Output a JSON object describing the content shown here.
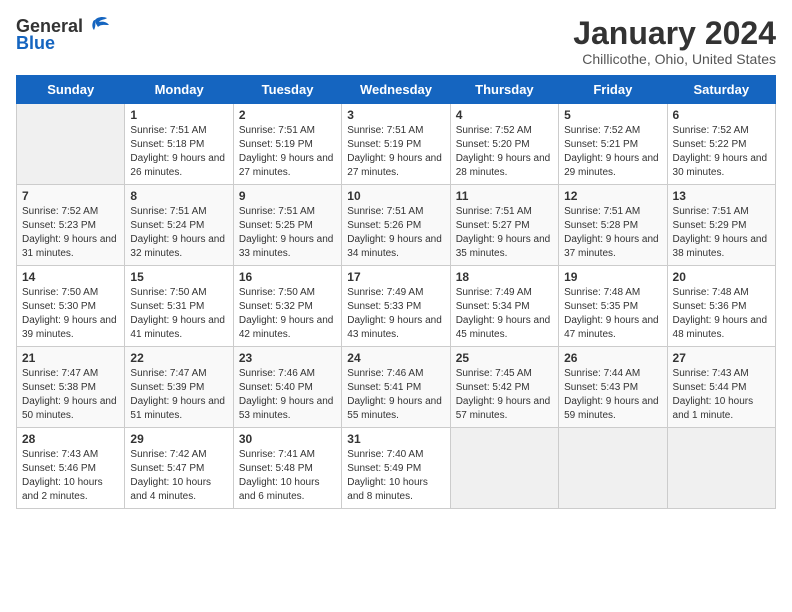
{
  "logo": {
    "text_general": "General",
    "text_blue": "Blue"
  },
  "title": "January 2024",
  "subtitle": "Chillicothe, Ohio, United States",
  "days_of_week": [
    "Sunday",
    "Monday",
    "Tuesday",
    "Wednesday",
    "Thursday",
    "Friday",
    "Saturday"
  ],
  "weeks": [
    [
      {
        "num": "",
        "empty": true
      },
      {
        "num": "1",
        "sunrise": "Sunrise: 7:51 AM",
        "sunset": "Sunset: 5:18 PM",
        "daylight": "Daylight: 9 hours and 26 minutes."
      },
      {
        "num": "2",
        "sunrise": "Sunrise: 7:51 AM",
        "sunset": "Sunset: 5:19 PM",
        "daylight": "Daylight: 9 hours and 27 minutes."
      },
      {
        "num": "3",
        "sunrise": "Sunrise: 7:51 AM",
        "sunset": "Sunset: 5:19 PM",
        "daylight": "Daylight: 9 hours and 27 minutes."
      },
      {
        "num": "4",
        "sunrise": "Sunrise: 7:52 AM",
        "sunset": "Sunset: 5:20 PM",
        "daylight": "Daylight: 9 hours and 28 minutes."
      },
      {
        "num": "5",
        "sunrise": "Sunrise: 7:52 AM",
        "sunset": "Sunset: 5:21 PM",
        "daylight": "Daylight: 9 hours and 29 minutes."
      },
      {
        "num": "6",
        "sunrise": "Sunrise: 7:52 AM",
        "sunset": "Sunset: 5:22 PM",
        "daylight": "Daylight: 9 hours and 30 minutes."
      }
    ],
    [
      {
        "num": "7",
        "sunrise": "Sunrise: 7:52 AM",
        "sunset": "Sunset: 5:23 PM",
        "daylight": "Daylight: 9 hours and 31 minutes."
      },
      {
        "num": "8",
        "sunrise": "Sunrise: 7:51 AM",
        "sunset": "Sunset: 5:24 PM",
        "daylight": "Daylight: 9 hours and 32 minutes."
      },
      {
        "num": "9",
        "sunrise": "Sunrise: 7:51 AM",
        "sunset": "Sunset: 5:25 PM",
        "daylight": "Daylight: 9 hours and 33 minutes."
      },
      {
        "num": "10",
        "sunrise": "Sunrise: 7:51 AM",
        "sunset": "Sunset: 5:26 PM",
        "daylight": "Daylight: 9 hours and 34 minutes."
      },
      {
        "num": "11",
        "sunrise": "Sunrise: 7:51 AM",
        "sunset": "Sunset: 5:27 PM",
        "daylight": "Daylight: 9 hours and 35 minutes."
      },
      {
        "num": "12",
        "sunrise": "Sunrise: 7:51 AM",
        "sunset": "Sunset: 5:28 PM",
        "daylight": "Daylight: 9 hours and 37 minutes."
      },
      {
        "num": "13",
        "sunrise": "Sunrise: 7:51 AM",
        "sunset": "Sunset: 5:29 PM",
        "daylight": "Daylight: 9 hours and 38 minutes."
      }
    ],
    [
      {
        "num": "14",
        "sunrise": "Sunrise: 7:50 AM",
        "sunset": "Sunset: 5:30 PM",
        "daylight": "Daylight: 9 hours and 39 minutes."
      },
      {
        "num": "15",
        "sunrise": "Sunrise: 7:50 AM",
        "sunset": "Sunset: 5:31 PM",
        "daylight": "Daylight: 9 hours and 41 minutes."
      },
      {
        "num": "16",
        "sunrise": "Sunrise: 7:50 AM",
        "sunset": "Sunset: 5:32 PM",
        "daylight": "Daylight: 9 hours and 42 minutes."
      },
      {
        "num": "17",
        "sunrise": "Sunrise: 7:49 AM",
        "sunset": "Sunset: 5:33 PM",
        "daylight": "Daylight: 9 hours and 43 minutes."
      },
      {
        "num": "18",
        "sunrise": "Sunrise: 7:49 AM",
        "sunset": "Sunset: 5:34 PM",
        "daylight": "Daylight: 9 hours and 45 minutes."
      },
      {
        "num": "19",
        "sunrise": "Sunrise: 7:48 AM",
        "sunset": "Sunset: 5:35 PM",
        "daylight": "Daylight: 9 hours and 47 minutes."
      },
      {
        "num": "20",
        "sunrise": "Sunrise: 7:48 AM",
        "sunset": "Sunset: 5:36 PM",
        "daylight": "Daylight: 9 hours and 48 minutes."
      }
    ],
    [
      {
        "num": "21",
        "sunrise": "Sunrise: 7:47 AM",
        "sunset": "Sunset: 5:38 PM",
        "daylight": "Daylight: 9 hours and 50 minutes."
      },
      {
        "num": "22",
        "sunrise": "Sunrise: 7:47 AM",
        "sunset": "Sunset: 5:39 PM",
        "daylight": "Daylight: 9 hours and 51 minutes."
      },
      {
        "num": "23",
        "sunrise": "Sunrise: 7:46 AM",
        "sunset": "Sunset: 5:40 PM",
        "daylight": "Daylight: 9 hours and 53 minutes."
      },
      {
        "num": "24",
        "sunrise": "Sunrise: 7:46 AM",
        "sunset": "Sunset: 5:41 PM",
        "daylight": "Daylight: 9 hours and 55 minutes."
      },
      {
        "num": "25",
        "sunrise": "Sunrise: 7:45 AM",
        "sunset": "Sunset: 5:42 PM",
        "daylight": "Daylight: 9 hours and 57 minutes."
      },
      {
        "num": "26",
        "sunrise": "Sunrise: 7:44 AM",
        "sunset": "Sunset: 5:43 PM",
        "daylight": "Daylight: 9 hours and 59 minutes."
      },
      {
        "num": "27",
        "sunrise": "Sunrise: 7:43 AM",
        "sunset": "Sunset: 5:44 PM",
        "daylight": "Daylight: 10 hours and 1 minute."
      }
    ],
    [
      {
        "num": "28",
        "sunrise": "Sunrise: 7:43 AM",
        "sunset": "Sunset: 5:46 PM",
        "daylight": "Daylight: 10 hours and 2 minutes."
      },
      {
        "num": "29",
        "sunrise": "Sunrise: 7:42 AM",
        "sunset": "Sunset: 5:47 PM",
        "daylight": "Daylight: 10 hours and 4 minutes."
      },
      {
        "num": "30",
        "sunrise": "Sunrise: 7:41 AM",
        "sunset": "Sunset: 5:48 PM",
        "daylight": "Daylight: 10 hours and 6 minutes."
      },
      {
        "num": "31",
        "sunrise": "Sunrise: 7:40 AM",
        "sunset": "Sunset: 5:49 PM",
        "daylight": "Daylight: 10 hours and 8 minutes."
      },
      {
        "num": "",
        "empty": true
      },
      {
        "num": "",
        "empty": true
      },
      {
        "num": "",
        "empty": true
      }
    ]
  ],
  "colors": {
    "header_bg": "#1565c0",
    "header_text": "#ffffff",
    "border": "#cccccc",
    "even_row": "#f9f9f9",
    "odd_row": "#ffffff",
    "empty_cell": "#f0f0f0"
  }
}
